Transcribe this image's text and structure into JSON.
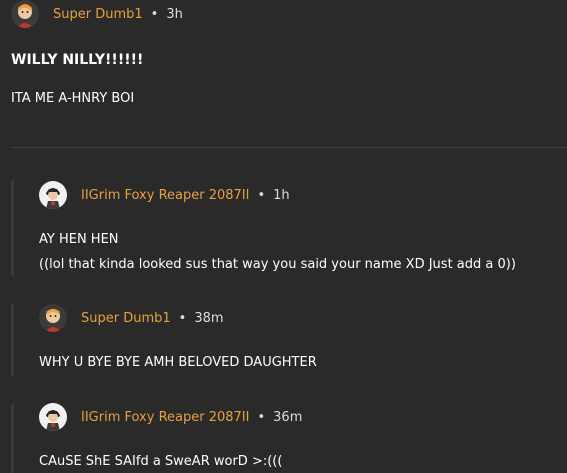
{
  "post": {
    "author": "Super Dumb1",
    "separator": "•",
    "time": "3h",
    "title": "WILLY NILLY!!!!!!",
    "body": "ITA ME A-HNRY BOI"
  },
  "replies": [
    {
      "author": "IIGrim Foxy Reaper 2087II",
      "separator": "•",
      "time": "1h",
      "avatar": "grim-avatar",
      "lines": [
        "AY HEN HEN",
        "((lol that kinda looked sus that way you said your name XD Just add a 0))"
      ]
    },
    {
      "author": "Super Dumb1",
      "separator": "•",
      "time": "38m",
      "avatar": "dumb-avatar",
      "lines": [
        "WHY U BYE BYE AMH BELOVED DAUGHTER"
      ]
    },
    {
      "author": "IIGrim Foxy Reaper 2087II",
      "separator": "•",
      "time": "36m",
      "avatar": "grim-avatar",
      "lines": [
        "CAuSE ShE SAIfd a SweAR worD >:((("
      ]
    }
  ],
  "colors": {
    "background": "#2a2a2a",
    "username": "#e8a13a",
    "text": "#ffffff",
    "muted": "#dddddd",
    "divider": "#3f3f3f"
  }
}
